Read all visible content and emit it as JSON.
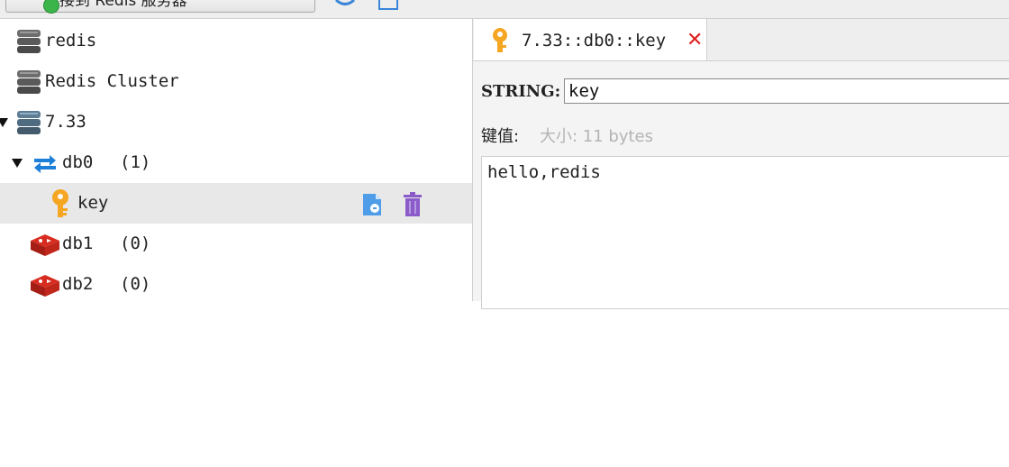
{
  "toolbar": {
    "connect_label": "连接到 Redis 服务器"
  },
  "tree": {
    "items": [
      {
        "label": "redis",
        "icon": "server-stack-icon"
      },
      {
        "label": "Redis Cluster",
        "icon": "server-stack-icon"
      },
      {
        "label": "7.33",
        "icon": "server-stack-icon"
      },
      {
        "label": "db0",
        "count": "(1)",
        "icon": "reload-arrows-icon"
      },
      {
        "label": "key",
        "icon": "key-icon",
        "actions": [
          "copy-file-icon",
          "trash-icon"
        ]
      },
      {
        "label": "db1",
        "count": "(0)",
        "icon": "redis-db-icon"
      },
      {
        "label": "db2",
        "count": "(0)",
        "icon": "redis-db-icon"
      }
    ]
  },
  "tab": {
    "title": "7.33::db0::key",
    "close": "✕"
  },
  "editor": {
    "type_label": "STRING:",
    "key_value": "key",
    "value_label": "键值:",
    "size_text": "大小: 11 bytes",
    "value_text": "hello,redis"
  },
  "colors": {
    "key_orange": "#f5a623",
    "redis_red": "#d82c20",
    "db_blue": "#1e7fd8",
    "trash_purple": "#8b5cc9",
    "close_red": "#e02020",
    "selected_row": "#e8e8e8"
  }
}
